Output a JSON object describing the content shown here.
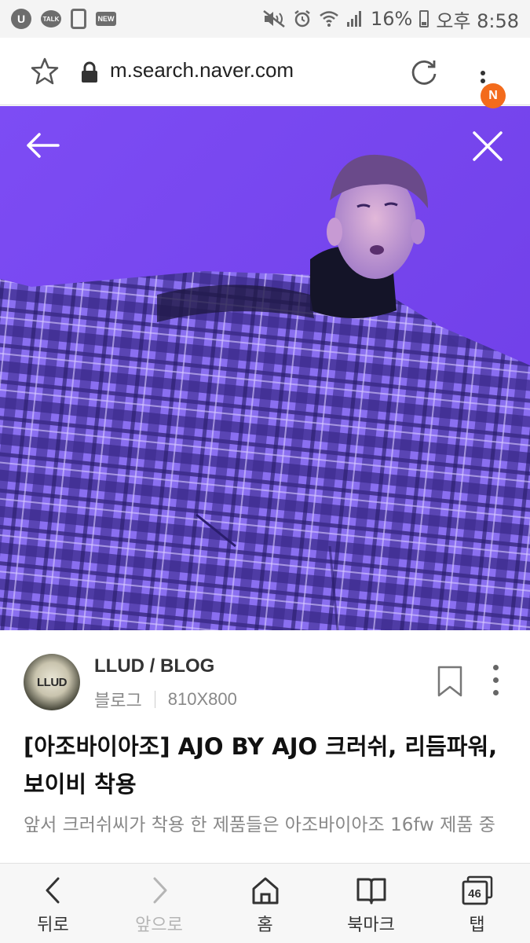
{
  "status_bar": {
    "battery": "16%",
    "time": "오후 8:58",
    "app_icons": [
      "u-plus-icon",
      "kakaotalk-icon",
      "phone-notification-icon",
      "new-badge-icon"
    ],
    "app_u_label": "U",
    "app_talk_label": "TALK",
    "app_new_label": "NEW"
  },
  "browser": {
    "url": "m.search.naver.com",
    "notification_badge": "N",
    "badge_color": "#f36b1c"
  },
  "result": {
    "avatar_text": "LLUD",
    "source_name": "LLUD / BLOG",
    "source_type": "블로그",
    "image_size": "810X800",
    "title": "[아조바이아조] AJO BY AJO 크러쉬, 리듬파워, 보이비 착용",
    "description": "앞서 크러쉬씨가 착용 한 제품들은 아조바이아조 16fw 제품 중"
  },
  "bottom_nav": {
    "items": [
      {
        "label": "뒤로",
        "icon": "back-arrow-icon",
        "enabled": true
      },
      {
        "label": "앞으로",
        "icon": "forward-arrow-icon",
        "enabled": false
      },
      {
        "label": "홈",
        "icon": "home-icon",
        "enabled": true
      },
      {
        "label": "북마크",
        "icon": "bookmark-book-icon",
        "enabled": true
      },
      {
        "label": "탭",
        "icon": "tabs-icon",
        "enabled": true
      }
    ],
    "tab_count": "46"
  }
}
